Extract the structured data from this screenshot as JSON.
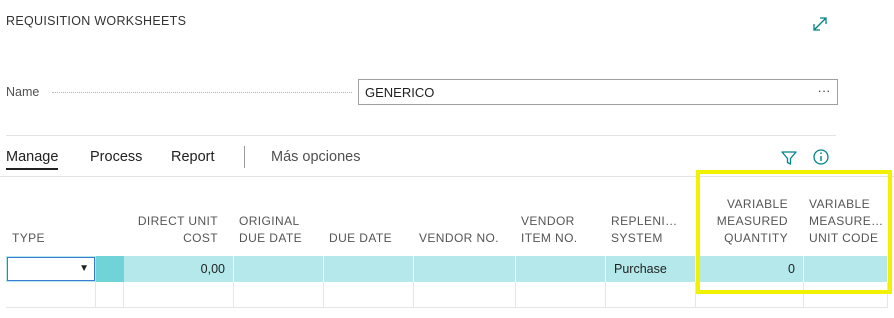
{
  "page": {
    "title": "REQUISITION WORKSHEETS"
  },
  "name_field": {
    "label": "Name",
    "value": "GENERICO",
    "lookup": "···"
  },
  "actions": {
    "manage": "Manage",
    "process": "Process",
    "report": "Report",
    "more": "Más opciones"
  },
  "columns": {
    "type": "TYPE",
    "direct_unit_cost_1": "DIRECT UNIT",
    "direct_unit_cost_2": "COST",
    "original_due_date_1": "ORIGINAL",
    "original_due_date_2": "DUE DATE",
    "due_date": "DUE DATE",
    "vendor_no": "VENDOR NO.",
    "vendor_item_no_1": "VENDOR",
    "vendor_item_no_2": "ITEM NO.",
    "replenishment_1": "REPLENI…",
    "replenishment_2": "SYSTEM",
    "var_qty_1": "VARIABLE",
    "var_qty_2": "MEASURED",
    "var_qty_3": "QUANTITY",
    "var_unit_1": "VARIABLE",
    "var_unit_2": "MEASURE…",
    "var_unit_3": "UNIT CODE"
  },
  "rows": [
    {
      "type": "",
      "direct_unit_cost": "0,00",
      "original_due_date": "",
      "due_date": "",
      "vendor_no": "",
      "vendor_item_no": "",
      "replenishment_system": "Purchase",
      "variable_measured_quantity": "0",
      "variable_measure_unit_code": ""
    }
  ],
  "colors": {
    "accent": "#008489",
    "row_selected": "#b4e8ea",
    "row_indicator": "#6fd3d8",
    "highlight": "#f2f200"
  },
  "icons": {
    "expand": "expand-icon",
    "filter": "filter-icon",
    "info": "info-icon",
    "dropdown": "chevron-down-icon"
  }
}
